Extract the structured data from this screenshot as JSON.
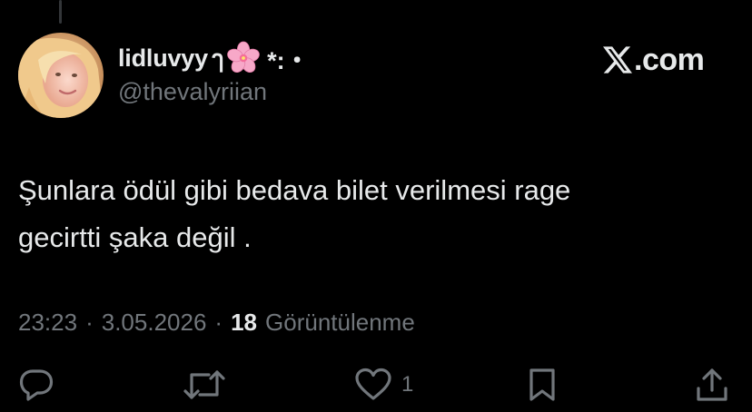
{
  "author": {
    "display_name": "lidluvyy",
    "name_decoration_prefix": "ๅ",
    "name_decoration_suffix": "*:・",
    "flower_emoji": "cherry-blossom-icon",
    "handle": "@thevalyriian"
  },
  "brand": {
    "logo": "x-logo-icon",
    "suffix": ".com"
  },
  "tweet": {
    "text_line1": "Şunlara ödül gibi bedava bilet verilmesi rage",
    "text_line2": "gecirtti şaka değil ."
  },
  "meta": {
    "time": "23:23",
    "separator": "·",
    "date": "3.05.2026",
    "views_count": "18",
    "views_label": "Görüntülenme"
  },
  "actions": {
    "reply_icon": "reply-icon",
    "repost_icon": "repost-icon",
    "like_icon": "heart-icon",
    "like_count": "1",
    "bookmark_icon": "bookmark-icon",
    "share_icon": "share-icon"
  },
  "colors": {
    "background": "#000000",
    "text_primary": "#e7e9ea",
    "text_secondary": "#71767b",
    "flower_pink": "#f7a8c8"
  }
}
